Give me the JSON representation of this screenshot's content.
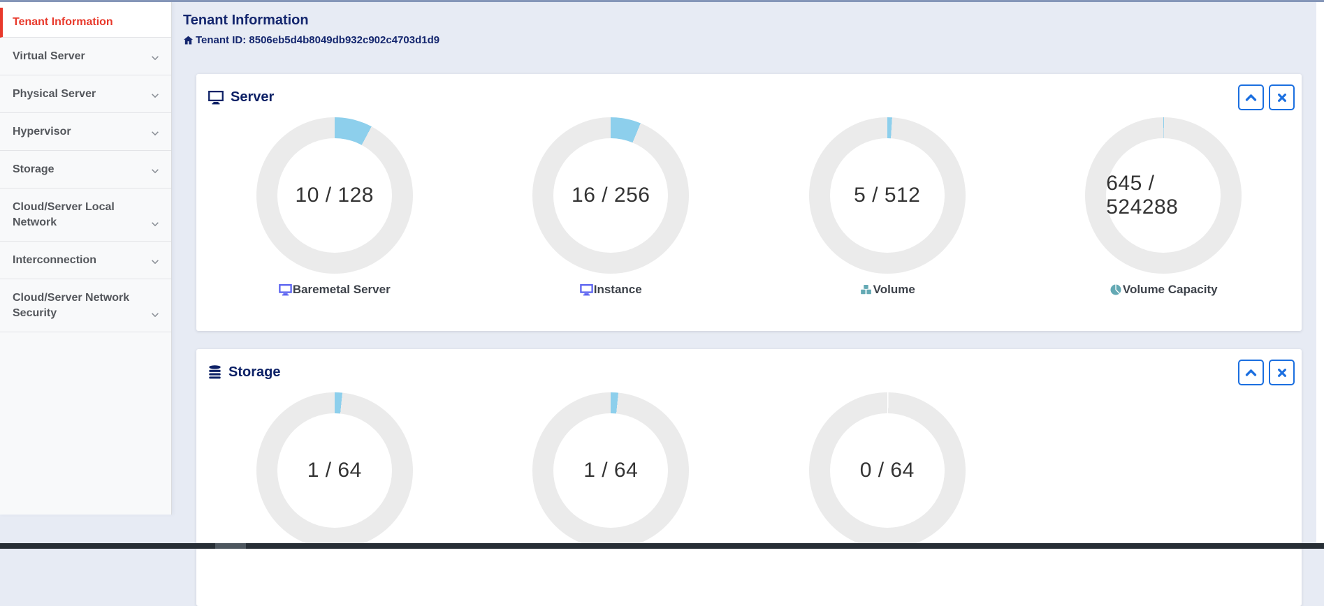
{
  "colors": {
    "topline": "#8596b8",
    "accent_red": "#e8392b",
    "navy_heading": "#14266e",
    "button_blue": "#1b6fe0",
    "donut_fill": "#8dcfec",
    "donut_track": "#ebebeb",
    "label_icon_indigo": "#5b63f0",
    "label_icon_teal": "#64a9b4"
  },
  "sidebar": {
    "items": [
      {
        "label": "Tenant Information",
        "active": true,
        "chevron": false
      },
      {
        "label": "Virtual Server",
        "active": false,
        "chevron": true
      },
      {
        "label": "Physical Server",
        "active": false,
        "chevron": true
      },
      {
        "label": "Hypervisor",
        "active": false,
        "chevron": true
      },
      {
        "label": "Storage",
        "active": false,
        "chevron": true
      },
      {
        "label": "Cloud/Server Local Network",
        "active": false,
        "chevron": true
      },
      {
        "label": "Interconnection",
        "active": false,
        "chevron": true
      },
      {
        "label": "Cloud/Server Network Security",
        "active": false,
        "chevron": true
      }
    ]
  },
  "header": {
    "title": "Tenant Information",
    "tenant_id_icon": "home-icon",
    "tenant_id": "Tenant ID: 8506eb5d4b8049db932c902c4703d1d9"
  },
  "panel_controls": {
    "collapse_icon": "chevron-up-icon",
    "close_icon": "close-icon"
  },
  "chart_data": [
    {
      "type": "donut",
      "panel_title": "Server",
      "panel_icon": "monitor-icon",
      "charts": [
        {
          "label": "Baremetal Server",
          "icon": "monitor-icon",
          "used": 10,
          "total": 128,
          "display": "10 / 128"
        },
        {
          "label": "Instance",
          "icon": "monitor-icon",
          "used": 16,
          "total": 256,
          "display": "16 / 256"
        },
        {
          "label": "Volume",
          "icon": "cubes-icon",
          "used": 5,
          "total": 512,
          "display": "5 / 512"
        },
        {
          "label": "Volume Capacity",
          "icon": "pie-chart-icon",
          "used": 645,
          "total": 524288,
          "display": "645 / 524288"
        }
      ]
    },
    {
      "type": "donut",
      "panel_title": "Storage",
      "panel_icon": "database-icon",
      "charts": [
        {
          "used": 1,
          "total": 64,
          "display": "1 / 64"
        },
        {
          "used": 1,
          "total": 64,
          "display": "1 / 64"
        },
        {
          "used": 0,
          "total": 64,
          "display": "0 / 64"
        }
      ]
    }
  ]
}
